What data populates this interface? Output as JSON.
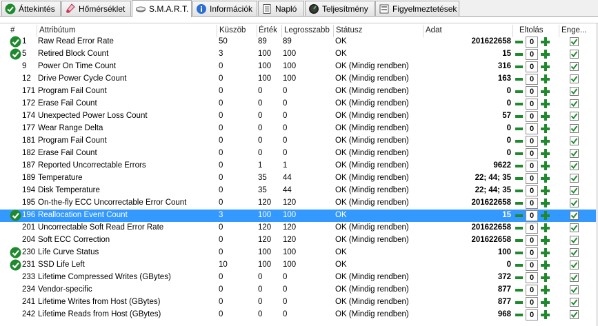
{
  "tabs": [
    {
      "label": "Áttekintés",
      "icon": "check-circle-icon"
    },
    {
      "label": "Hőmérséklet",
      "icon": "thermometer-icon"
    },
    {
      "label": "S.M.A.R.T.",
      "icon": "disk-icon",
      "active": true
    },
    {
      "label": "Információk",
      "icon": "info-icon"
    },
    {
      "label": "Napló",
      "icon": "log-icon"
    },
    {
      "label": "Teljesítmény",
      "icon": "gauge-icon"
    },
    {
      "label": "Figyelmeztetések",
      "icon": "alerts-icon"
    }
  ],
  "columns": {
    "num": "#",
    "attr": "Attribútum",
    "thr": "Küszöb",
    "val": "Érték",
    "worst": "Legrosszabb",
    "status": "Státusz",
    "data": "Adat",
    "offset": "Eltolás",
    "enabled": "Enge..."
  },
  "rows": [
    {
      "ok": true,
      "num": "1",
      "attr": "Raw Read Error Rate",
      "thr": "50",
      "val": "89",
      "worst": "89",
      "status": "OK",
      "data": "201622658",
      "offset": "0",
      "enabled": true
    },
    {
      "ok": true,
      "num": "5",
      "attr": "Retired Block Count",
      "thr": "3",
      "val": "100",
      "worst": "100",
      "status": "OK",
      "data": "15",
      "offset": "0",
      "enabled": true
    },
    {
      "ok": false,
      "num": "9",
      "attr": "Power On Time Count",
      "thr": "0",
      "val": "100",
      "worst": "100",
      "status": "OK (Mindig rendben)",
      "data": "316",
      "offset": "0",
      "enabled": true
    },
    {
      "ok": false,
      "num": "12",
      "attr": "Drive Power Cycle Count",
      "thr": "0",
      "val": "100",
      "worst": "100",
      "status": "OK (Mindig rendben)",
      "data": "163",
      "offset": "0",
      "enabled": true
    },
    {
      "ok": false,
      "num": "171",
      "attr": "Program Fail Count",
      "thr": "0",
      "val": "0",
      "worst": "0",
      "status": "OK (Mindig rendben)",
      "data": "0",
      "offset": "0",
      "enabled": true
    },
    {
      "ok": false,
      "num": "172",
      "attr": "Erase Fail Count",
      "thr": "0",
      "val": "0",
      "worst": "0",
      "status": "OK (Mindig rendben)",
      "data": "0",
      "offset": "0",
      "enabled": true
    },
    {
      "ok": false,
      "num": "174",
      "attr": "Unexpected Power Loss Count",
      "thr": "0",
      "val": "0",
      "worst": "0",
      "status": "OK (Mindig rendben)",
      "data": "57",
      "offset": "0",
      "enabled": true
    },
    {
      "ok": false,
      "num": "177",
      "attr": "Wear Range Delta",
      "thr": "0",
      "val": "0",
      "worst": "0",
      "status": "OK (Mindig rendben)",
      "data": "0",
      "offset": "0",
      "enabled": true
    },
    {
      "ok": false,
      "num": "181",
      "attr": "Program Fail Count",
      "thr": "0",
      "val": "0",
      "worst": "0",
      "status": "OK (Mindig rendben)",
      "data": "0",
      "offset": "0",
      "enabled": true
    },
    {
      "ok": false,
      "num": "182",
      "attr": "Erase Fail Count",
      "thr": "0",
      "val": "0",
      "worst": "0",
      "status": "OK (Mindig rendben)",
      "data": "0",
      "offset": "0",
      "enabled": true
    },
    {
      "ok": false,
      "num": "187",
      "attr": "Reported Uncorrectable Errors",
      "thr": "0",
      "val": "1",
      "worst": "1",
      "status": "OK (Mindig rendben)",
      "data": "9622",
      "offset": "0",
      "enabled": true
    },
    {
      "ok": false,
      "num": "189",
      "attr": "Temperature",
      "thr": "0",
      "val": "35",
      "worst": "44",
      "status": "OK (Mindig rendben)",
      "data": "22; 44; 35",
      "offset": "0",
      "enabled": true
    },
    {
      "ok": false,
      "num": "194",
      "attr": "Disk Temperature",
      "thr": "0",
      "val": "35",
      "worst": "44",
      "status": "OK (Mindig rendben)",
      "data": "22; 44; 35",
      "offset": "0",
      "enabled": true
    },
    {
      "ok": false,
      "num": "195",
      "attr": "On-the-fly ECC Uncorrectable Error Count",
      "thr": "0",
      "val": "120",
      "worst": "120",
      "status": "OK (Mindig rendben)",
      "data": "201622658",
      "offset": "0",
      "enabled": true
    },
    {
      "ok": true,
      "num": "196",
      "attr": "Reallocation Event Count",
      "thr": "3",
      "val": "100",
      "worst": "100",
      "status": "OK",
      "data": "15",
      "offset": "0",
      "enabled": true,
      "selected": true
    },
    {
      "ok": false,
      "num": "201",
      "attr": "Uncorrectable Soft Read Error Rate",
      "thr": "0",
      "val": "120",
      "worst": "120",
      "status": "OK (Mindig rendben)",
      "data": "201622658",
      "offset": "0",
      "enabled": true
    },
    {
      "ok": false,
      "num": "204",
      "attr": "Soft ECC Correction",
      "thr": "0",
      "val": "120",
      "worst": "120",
      "status": "OK (Mindig rendben)",
      "data": "201622658",
      "offset": "0",
      "enabled": true
    },
    {
      "ok": true,
      "num": "230",
      "attr": "Life Curve Status",
      "thr": "0",
      "val": "100",
      "worst": "100",
      "status": "OK",
      "data": "100",
      "offset": "0",
      "enabled": true
    },
    {
      "ok": true,
      "num": "231",
      "attr": "SSD Life Left",
      "thr": "10",
      "val": "100",
      "worst": "100",
      "status": "OK",
      "data": "0",
      "offset": "0",
      "enabled": true
    },
    {
      "ok": false,
      "num": "233",
      "attr": "Lifetime Compressed Writes (GBytes)",
      "thr": "0",
      "val": "0",
      "worst": "0",
      "status": "OK (Mindig rendben)",
      "data": "372",
      "offset": "0",
      "enabled": true
    },
    {
      "ok": false,
      "num": "234",
      "attr": "Vendor-specific",
      "thr": "0",
      "val": "0",
      "worst": "0",
      "status": "OK (Mindig rendben)",
      "data": "877",
      "offset": "0",
      "enabled": true
    },
    {
      "ok": false,
      "num": "241",
      "attr": "Lifetime Writes from Host (GBytes)",
      "thr": "0",
      "val": "0",
      "worst": "0",
      "status": "OK (Mindig rendben)",
      "data": "877",
      "offset": "0",
      "enabled": true
    },
    {
      "ok": false,
      "num": "242",
      "attr": "Lifetime Reads from Host (GBytes)",
      "thr": "0",
      "val": "0",
      "worst": "0",
      "status": "OK (Mindig rendben)",
      "data": "968",
      "offset": "0",
      "enabled": true
    }
  ],
  "colors": {
    "ok_green": "#1f8a2d",
    "selection": "#3399ff"
  }
}
